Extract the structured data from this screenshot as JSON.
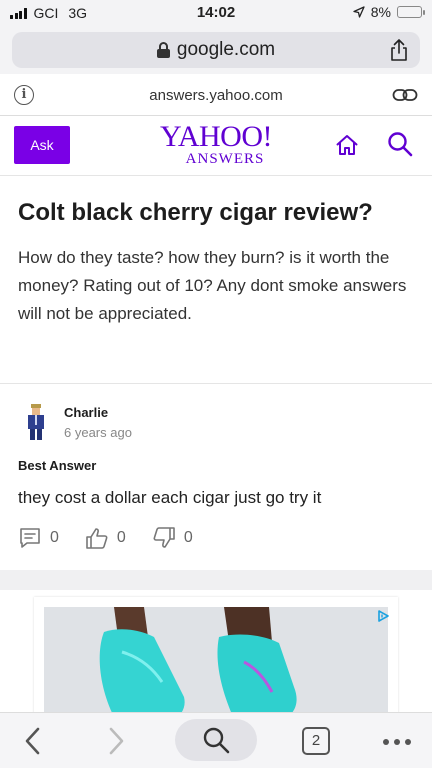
{
  "status_bar": {
    "carrier": "GCI",
    "network": "3G",
    "time": "14:02",
    "battery": "8%",
    "battery_level": 0.08
  },
  "browser": {
    "url": "google.com",
    "page_domain": "answers.yahoo.com",
    "open_tabs": "2"
  },
  "header": {
    "ask_label": "Ask",
    "logo_main": "YAHOO!",
    "logo_sub": "ANSWERS",
    "brand_color": "#6001d2",
    "ask_color": "#7a00e6"
  },
  "question": {
    "title": "Colt black cherry cigar review?",
    "body": "How do they taste? how they burn? is it worth the money? Rating out of 10? Any dont smoke answers will not be appreciated."
  },
  "answer": {
    "author": "Charlie",
    "time": "6 years ago",
    "badge": "Best Answer",
    "text": "they cost a dollar each cigar just go try it",
    "comments": "0",
    "likes": "0",
    "dislikes": "0"
  },
  "icons": {
    "info": "info-icon",
    "share": "share-icon",
    "link": "link-icon",
    "home": "home-icon",
    "search": "search-icon",
    "ad_choices": "ad-choices-icon"
  }
}
